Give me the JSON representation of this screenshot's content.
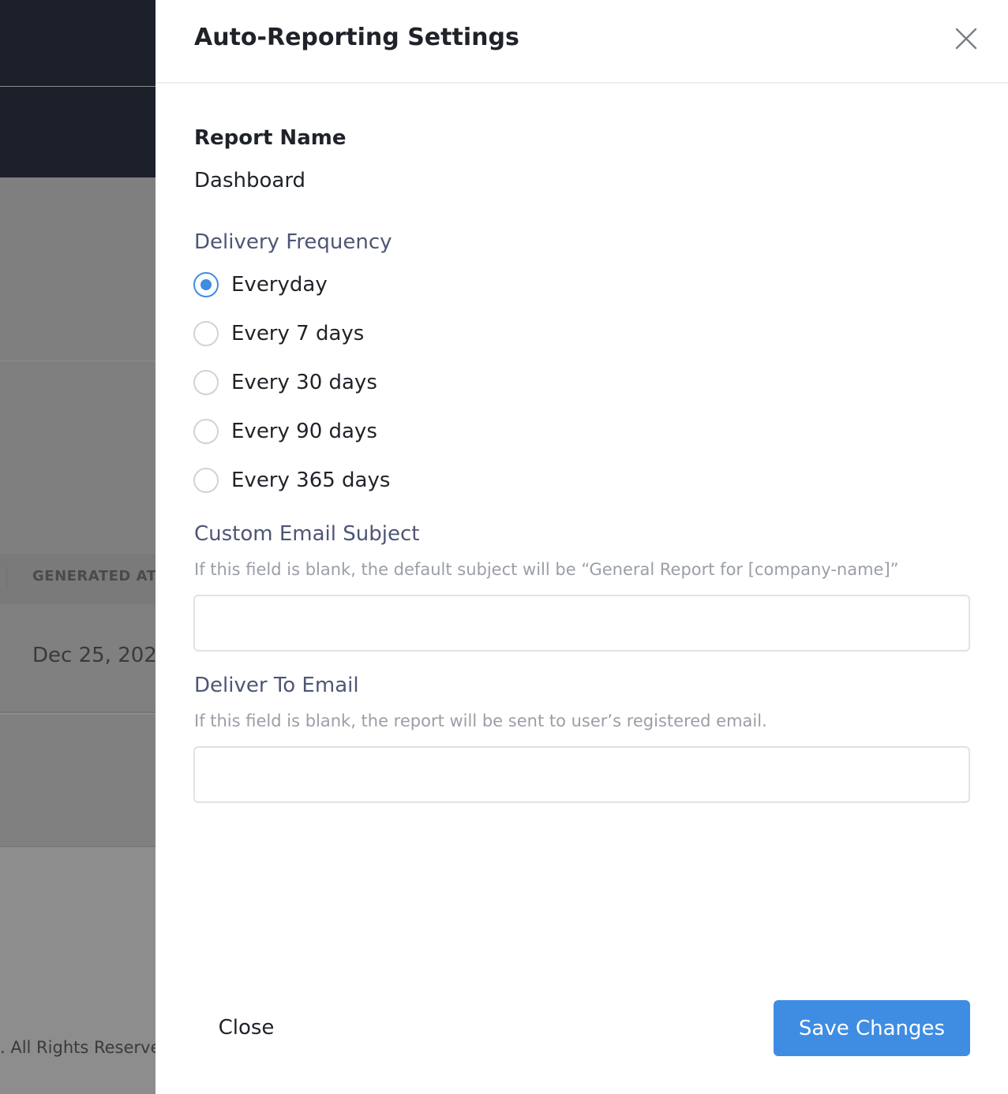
{
  "background": {
    "column_header": "GENERATED AT",
    "row_date": "Dec 25, 202",
    "footer_text": ". All Rights Reserve"
  },
  "drawer": {
    "title": "Auto-Reporting Settings",
    "close_icon": "close-icon",
    "report_name": {
      "label": "Report Name",
      "value": "Dashboard"
    },
    "delivery_frequency": {
      "label": "Delivery Frequency",
      "selected": "Everyday",
      "options": [
        {
          "label": "Everyday",
          "checked": true
        },
        {
          "label": "Every 7 days",
          "checked": false
        },
        {
          "label": "Every 30 days",
          "checked": false
        },
        {
          "label": "Every 90 days",
          "checked": false
        },
        {
          "label": "Every 365 days",
          "checked": false
        }
      ]
    },
    "custom_subject": {
      "label": "Custom Email Subject",
      "hint": "If this field is blank, the default subject will be “General Report for [company-name]”",
      "value": ""
    },
    "deliver_to": {
      "label": "Deliver To Email",
      "hint": "If this field is blank, the report will be sent to user’s registered email.",
      "value": ""
    },
    "buttons": {
      "close_label": "Close",
      "save_label": "Save Changes"
    }
  },
  "colors": {
    "accent": "#3f8ce3",
    "topbar": "#1b202b",
    "label": "#4d5675",
    "hint": "#9a9ea6"
  }
}
